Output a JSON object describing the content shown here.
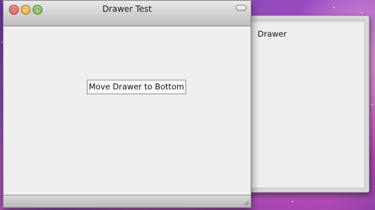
{
  "window": {
    "title": "Drawer Test",
    "controls": {
      "close": "close-button",
      "minimize": "minimize-button",
      "zoom": "zoom-button",
      "toolbar_toggle": "toolbar-toggle-button"
    }
  },
  "main": {
    "button_label": "Move Drawer to Bottom"
  },
  "drawer": {
    "label": "Drawer"
  },
  "colors": {
    "close": "#d2322b",
    "minimize": "#d98d0f",
    "zoom": "#3d9b25",
    "desktop_accent": "#9a4ec0"
  }
}
